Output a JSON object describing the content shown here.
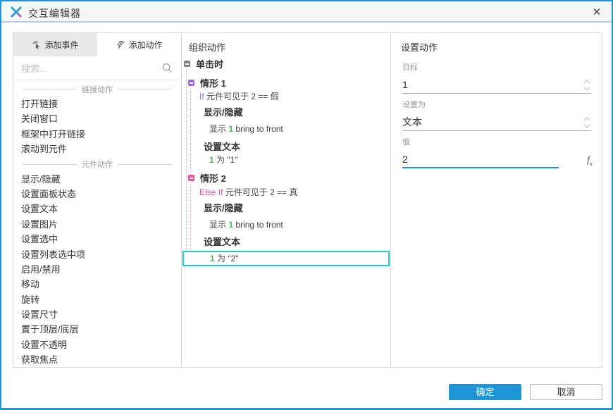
{
  "window": {
    "title": "交互编辑器",
    "close_icon": "✕"
  },
  "colors": {
    "accent_blue": "#1E96D4",
    "case_purple": "#9B6BE4",
    "case_pink": "#E8519E",
    "target_green": "#55B054",
    "selection_cyan": "#1FC8CA"
  },
  "left_panel": {
    "tabs": [
      {
        "label": "添加事件"
      },
      {
        "label": "添加动作"
      }
    ],
    "search_placeholder": "搜索...",
    "sections": [
      {
        "header": "链接动作",
        "items": [
          "打开链接",
          "关闭窗口",
          "框架中打开链接",
          "滚动到元件"
        ]
      },
      {
        "header": "元件动作",
        "items": [
          "显示/隐藏",
          "设置面板状态",
          "设置文本",
          "设置图片",
          "设置选中",
          "设置列表选中项",
          "启用/禁用",
          "移动",
          "旋转",
          "设置尺寸",
          "置于顶层/底层",
          "设置不透明",
          "获取焦点"
        ]
      }
    ]
  },
  "organize_panel": {
    "header": "组织动作",
    "event_label": "单击时",
    "case1": {
      "label": "情形 1",
      "keyword": "If",
      "condition": "元件可见于 2 == 假",
      "action1_title": "显示/隐藏",
      "action1_prefix": "显示",
      "action1_target": "1",
      "action1_suffix": "bring to front",
      "action2_title": "设置文本",
      "action2_target": "1",
      "action2_suffix": "为 \"1\""
    },
    "case2": {
      "label": "情形 2",
      "keyword": "Else If",
      "condition": "元件可见于 2 == 真",
      "action1_title": "显示/隐藏",
      "action1_prefix": "显示",
      "action1_target": "1",
      "action1_suffix": "bring to front",
      "action2_title": "设置文本",
      "action2_target": "1",
      "action2_suffix": "为 \"2\""
    }
  },
  "settings_panel": {
    "header": "设置动作",
    "fields": [
      {
        "label": "目标",
        "value": "1"
      },
      {
        "label": "设置为",
        "value": "文本"
      },
      {
        "label": "值",
        "value": "2"
      }
    ],
    "fx_label": "fx"
  },
  "footer": {
    "ok": "确定",
    "cancel": "取消"
  }
}
